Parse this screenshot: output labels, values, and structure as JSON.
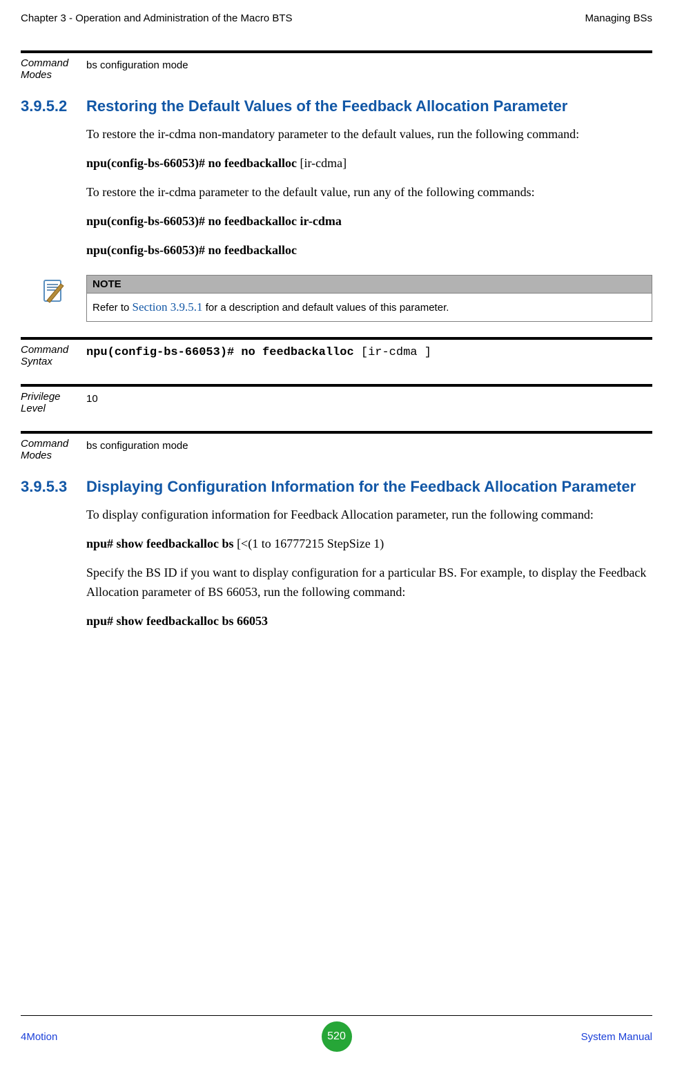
{
  "header": {
    "left": "Chapter 3 - Operation and Administration of the Macro BTS",
    "right": "Managing BSs"
  },
  "block1": {
    "label": "Command Modes",
    "value": "bs configuration mode"
  },
  "sec3952": {
    "number": "3.9.5.2",
    "title": "Restoring the Default Values of the Feedback Allocation Parameter",
    "p1": "To restore the ir-cdma non-mandatory parameter to the default values, run the following command:",
    "cmd1a": "npu(config-bs-66053)# no feedbackalloc",
    "cmd1b": " [ir-cdma]",
    "p2": "To restore the ir-cdma parameter to the default value, run any of the following commands:",
    "cmd2": "npu(config-bs-66053)# no feedbackalloc ir-cdma",
    "cmd3": "npu(config-bs-66053)# no feedbackalloc"
  },
  "note": {
    "header": "NOTE",
    "prefix": "Refer to ",
    "link": "Section 3.9.5.1",
    "suffix": " for a description and default values of this parameter."
  },
  "block2": {
    "label": "Command Syntax",
    "code_bold": "npu(config-bs-66053)# no feedbackalloc",
    "code_rest": " [ir-cdma ]"
  },
  "block3": {
    "label": "Privilege Level",
    "value": "10"
  },
  "block4": {
    "label": "Command Modes",
    "value": "bs configuration mode"
  },
  "sec3953": {
    "number": "3.9.5.3",
    "title": "Displaying Configuration Information for the Feedback Allocation Parameter",
    "p1": "To display configuration information for Feedback Allocation parameter, run the following command:",
    "cmd1a": "npu# show feedbackalloc bs",
    "cmd1b": " [<(1 to 16777215 StepSize 1)",
    "p2": "Specify the BS ID if you want to display configuration for a particular BS. For example, to display the Feedback Allocation parameter of BS 66053, run the following command:",
    "cmd2": "npu# show feedbackalloc bs 66053"
  },
  "footer": {
    "left": "4Motion",
    "page": "520",
    "right": "System Manual"
  }
}
